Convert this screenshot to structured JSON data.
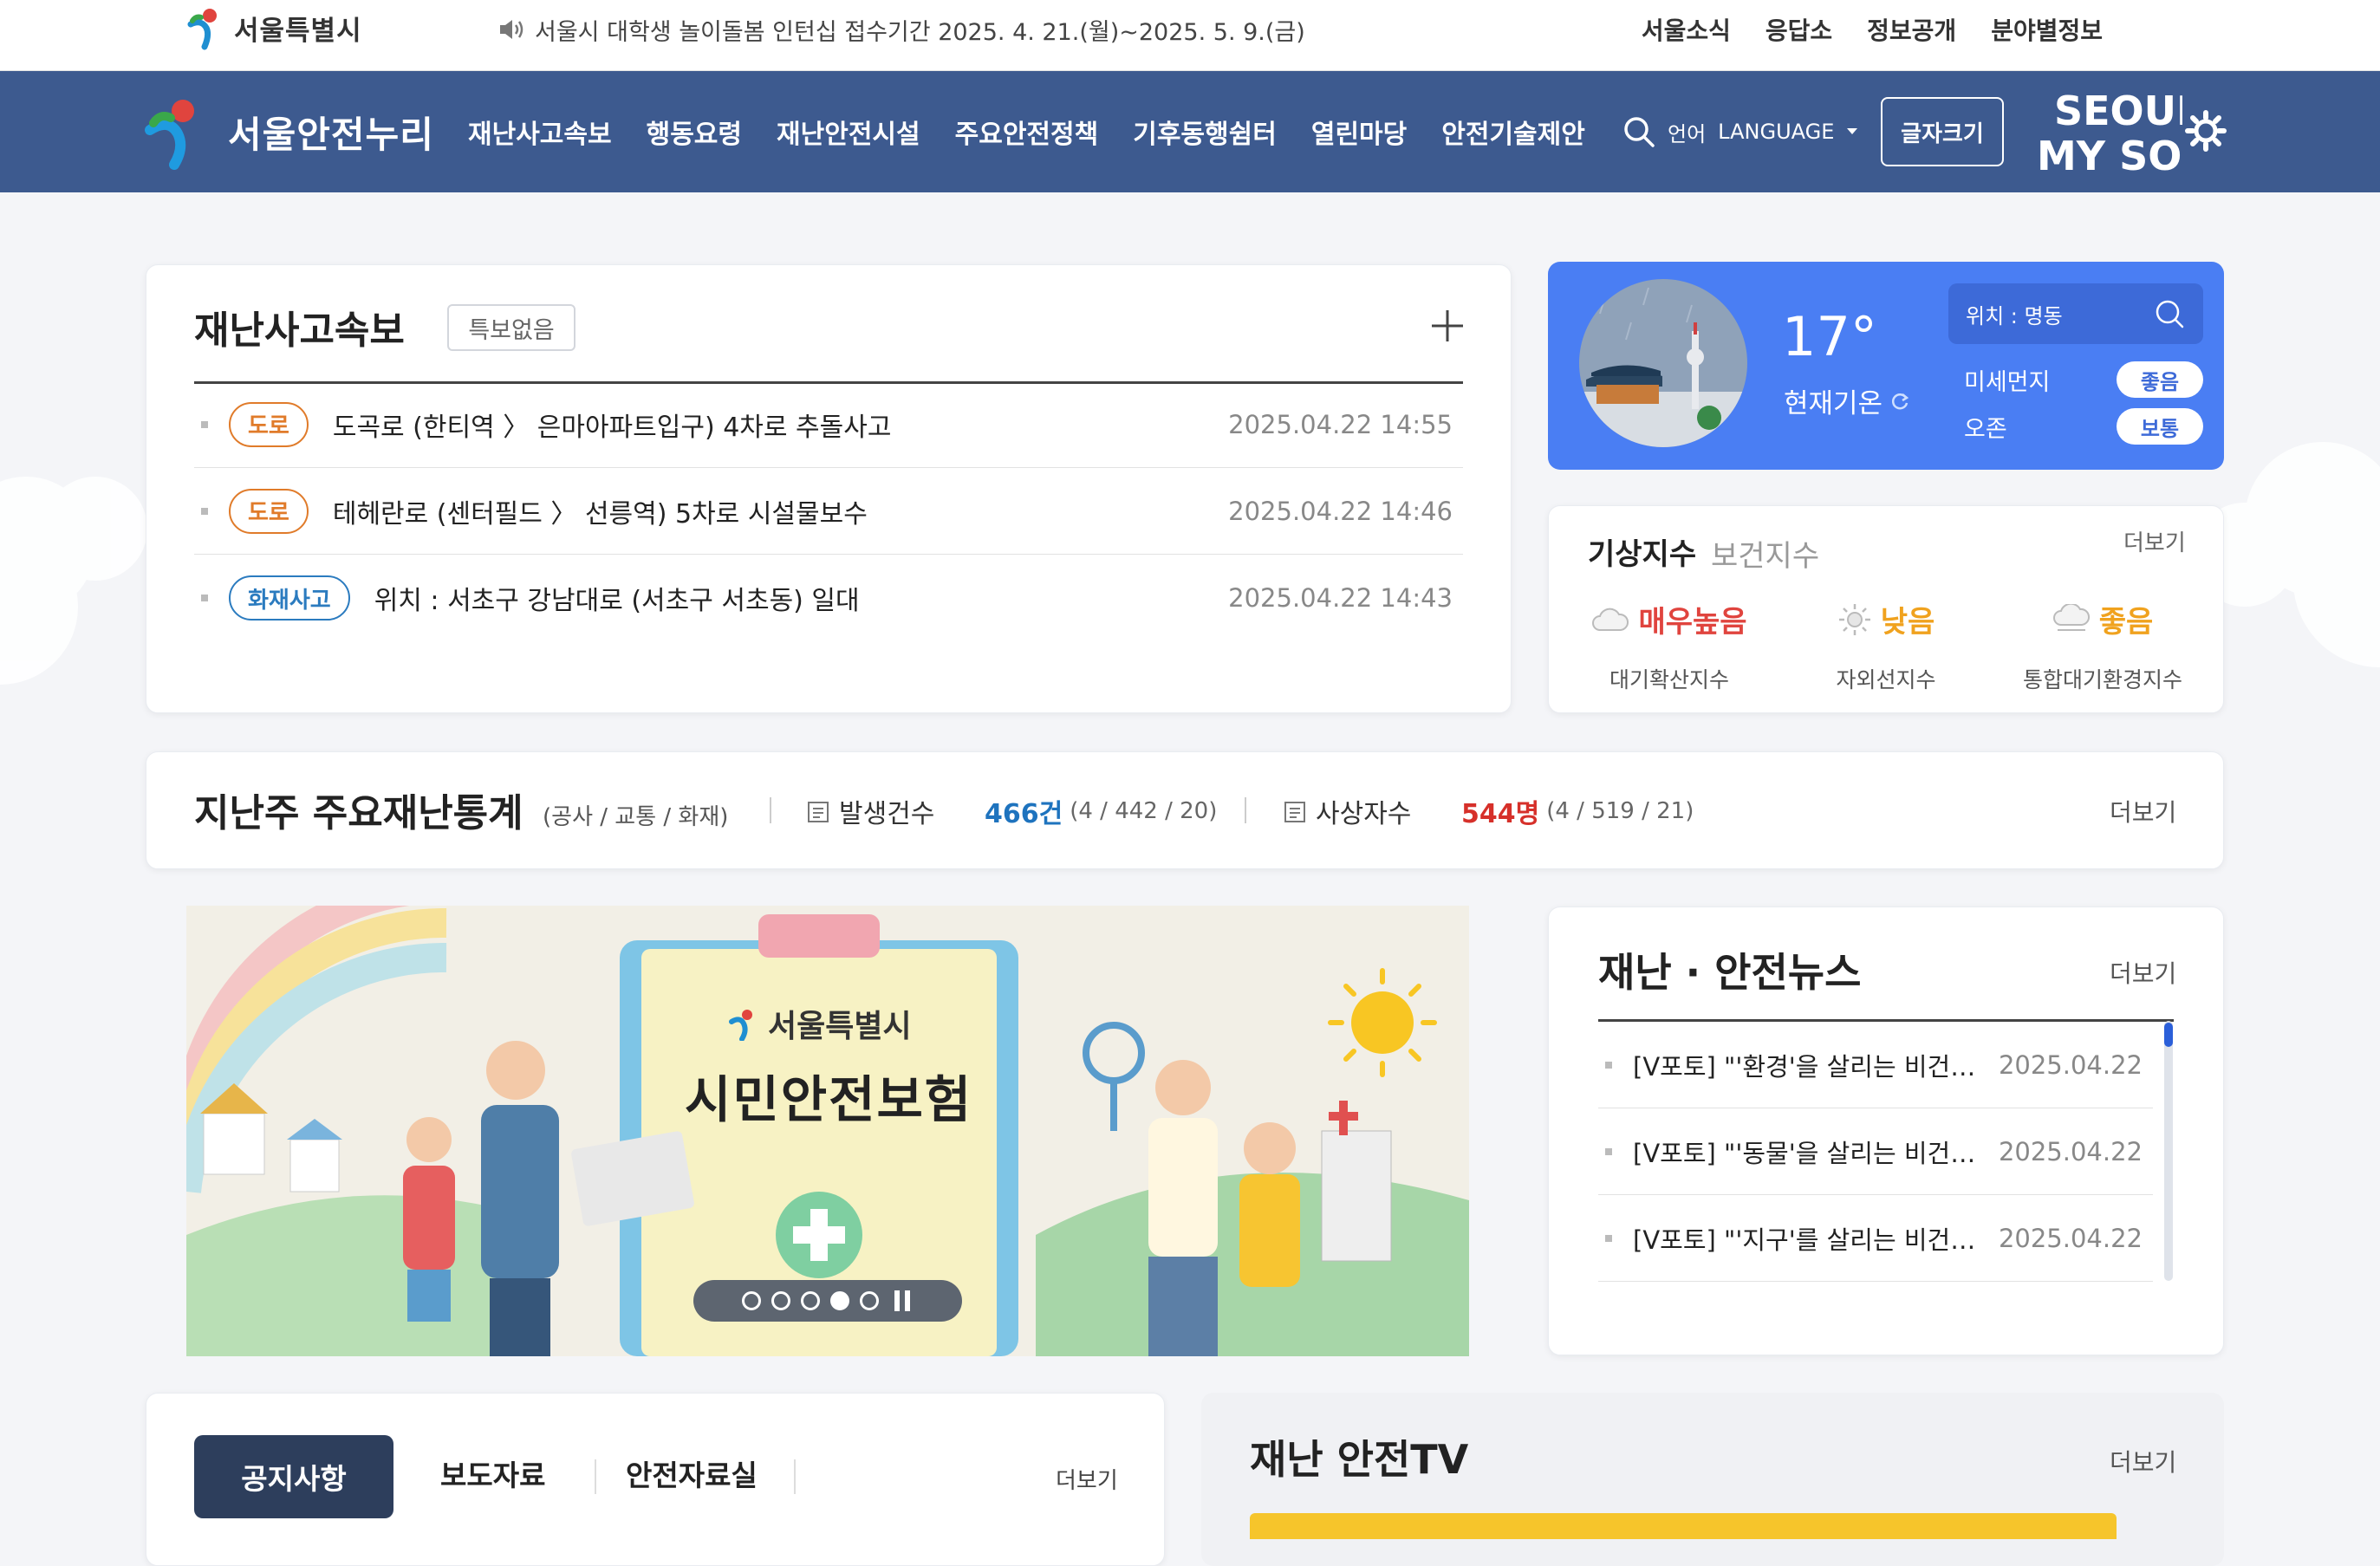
{
  "topbar": {
    "gov_name": "서울특별시",
    "notice": "서울시 대학생 놀이돌봄 인턴십 접수기간 2025. 4. 21.(월)~2025. 5. 9.(금)",
    "links": [
      "서울소식",
      "응답소",
      "정보공개",
      "분야별정보"
    ]
  },
  "nav": {
    "site_name": "서울안전누리",
    "menu": [
      "재난사고속보",
      "행동요령",
      "재난안전시설",
      "주요안전정책",
      "기후동행쉼터",
      "열린마당",
      "안전기술제안"
    ],
    "lang_label": "언어",
    "lang_value": "LANGUAGE",
    "fontsize_label": "글자크기",
    "brand_top": "SEOUL",
    "brand_bottom": "MY SOUL"
  },
  "accidents": {
    "title": "재난사고속보",
    "badge": "특보없음",
    "rows": [
      {
        "tag": "도로",
        "tag_type": "road",
        "text": "도곡로 (한티역 〉 은마아파트입구) 4차로 추돌사고",
        "date": "2025.04.22 14:55"
      },
      {
        "tag": "도로",
        "tag_type": "road",
        "text": "테헤란로 (센터필드 〉 선릉역) 5차로 시설물보수",
        "date": "2025.04.22 14:46"
      },
      {
        "tag": "화재사고",
        "tag_type": "fire",
        "text": "위치 : 서초구 강남대로 (서초구 서초동) 일대",
        "date": "2025.04.22 14:43"
      }
    ]
  },
  "weather": {
    "temp": "17°",
    "temp_label": "현재기온",
    "location": "위치 : 명동",
    "fine_dust_label": "미세먼지",
    "fine_dust_value": "좋음",
    "ozone_label": "오존",
    "ozone_value": "보통"
  },
  "indices": {
    "title": "기상지수",
    "subtitle": "보건지수",
    "more": "더보기",
    "items": [
      {
        "value": "매우높음",
        "label": "대기확산지수",
        "color": "#e0443e",
        "icon": "cloud-icon"
      },
      {
        "value": "낮음",
        "label": "자외선지수",
        "color": "#f0a21e",
        "icon": "sun-icon"
      },
      {
        "value": "좋음",
        "label": "통합대기환경지수",
        "color": "#f0a21e",
        "icon": "cloud-icon"
      }
    ]
  },
  "stats": {
    "title": "지난주 주요재난통계",
    "subtitle": "(공사 / 교통 / 화재)",
    "occur_label": "발생건수",
    "occur_value": "466건",
    "occur_detail": "(4 / 442 / 20)",
    "casualty_label": "사상자수",
    "casualty_value": "544명",
    "casualty_detail": "(4 / 519 / 21)",
    "more": "더보기",
    "occur_color": "#1e73be",
    "casualty_color": "#d6302a"
  },
  "banner": {
    "logo_text": "서울특별시",
    "title": "시민안전보험",
    "slide_count": 5,
    "active_slide": 4
  },
  "news": {
    "title": "재난 · 안전뉴스",
    "more": "더보기",
    "rows": [
      {
        "text": "[V포토] \"'환경'을 살리는 비건…",
        "date": "2025.04.22"
      },
      {
        "text": "[V포토] \"'동물'을 살리는 비건…",
        "date": "2025.04.22"
      },
      {
        "text": "[V포토] \"'지구'를 살리는 비건…",
        "date": "2025.04.22"
      }
    ]
  },
  "board": {
    "tabs": [
      "공지사항",
      "보도자료",
      "안전자료실"
    ],
    "more": "더보기"
  },
  "tv": {
    "title": "재난 안전TV",
    "more": "더보기"
  },
  "colors": {
    "nav_bg": "#3d5a8f",
    "weather_bg": "#4a7ef3",
    "active_tab": "#2d3e5c"
  }
}
